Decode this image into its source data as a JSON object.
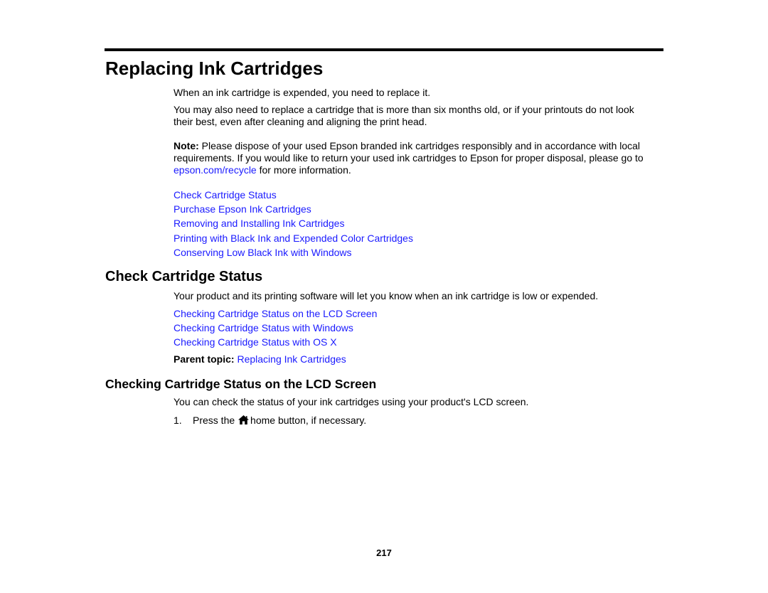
{
  "section_title": "Replacing Ink Cartridges",
  "intro": {
    "para1": "When an ink cartridge is expended, you need to replace it.",
    "para2": "You may also need to replace a cartridge that is more than six months old, or if your printouts do not look their best, even after cleaning and aligning the print head.",
    "note_label": "Note:",
    "note_text_before": " Please dispose of your used Epson branded ink cartridges responsibly and in accordance with local requirements. If you would like to return your used ink cartridges to Epson for proper disposal, please go to ",
    "note_link": "epson.com/recycle",
    "note_text_after": " for more information."
  },
  "topic_links": [
    "Check Cartridge Status",
    "Purchase Epson Ink Cartridges",
    "Removing and Installing Ink Cartridges",
    "Printing with Black Ink and Expended Color Cartridges",
    "Conserving Low Black Ink with Windows"
  ],
  "check_status": {
    "title": "Check Cartridge Status",
    "body": "Your product and its printing software will let you know when an ink cartridge is low or expended.",
    "links": [
      "Checking Cartridge Status on the LCD Screen",
      "Checking Cartridge Status with Windows",
      "Checking Cartridge Status with OS X"
    ],
    "parent_label": "Parent topic:",
    "parent_link": "Replacing Ink Cartridges"
  },
  "lcd_section": {
    "title": "Checking Cartridge Status on the LCD Screen",
    "body": "You can check the status of your ink cartridges using your product's LCD screen.",
    "step_number": "1.",
    "step_before": "Press the",
    "step_icon": "home-icon",
    "step_after": "home button, if necessary."
  },
  "page_number": "217",
  "colors": {
    "link": "#1a1aff",
    "text": "#000000",
    "rule": "#000000"
  }
}
